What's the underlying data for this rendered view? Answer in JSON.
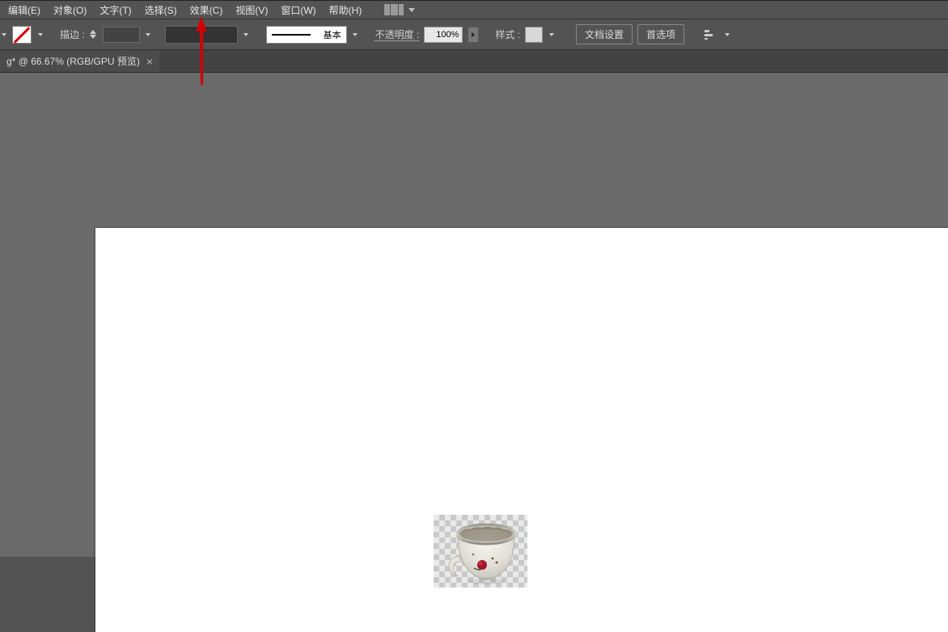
{
  "menu": {
    "items": [
      "编辑(E)",
      "对象(O)",
      "文字(T)",
      "选择(S)",
      "效果(C)",
      "视图(V)",
      "窗口(W)",
      "帮助(H)"
    ]
  },
  "options": {
    "stroke_label": "描边 :",
    "stroke_width": "",
    "stroke_profile": "基本",
    "opacity_label": "不透明度 :",
    "opacity_value": "100%",
    "style_label": "样式 :",
    "doc_setup_btn": "文档设置",
    "prefs_btn": "首选项"
  },
  "tab": {
    "label": "g* @ 66.67% (RGB/GPU 预览)"
  },
  "annotation": {
    "target_menu": "效果(C)",
    "color": "#d70000"
  }
}
